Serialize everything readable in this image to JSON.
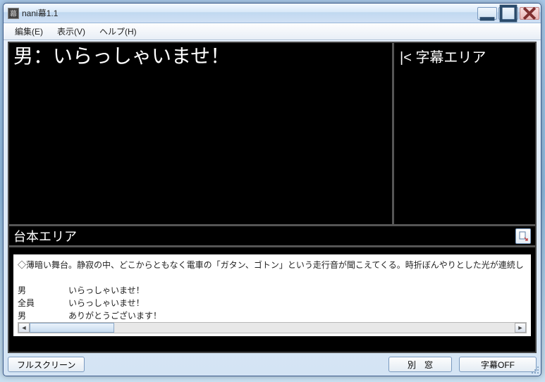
{
  "window": {
    "title": "nani幕1.1"
  },
  "menu": {
    "edit": "編集(E)",
    "view": "表示(V)",
    "help": "ヘルプ(H)"
  },
  "subtitle": {
    "main_text": "男：いらっしゃいませ！",
    "side_prefix": "|<",
    "side_label": "字幕エリア"
  },
  "script": {
    "header": "台本エリア",
    "direction": "◇薄暗い舞台。静寂の中、どこからともなく電車の「ガタン、ゴトン」という走行音が聞こえてくる。時折ぼんやりとした光が連続し",
    "lines": [
      {
        "speaker": "男",
        "text": "いらっしゃいませ！"
      },
      {
        "speaker": "全員",
        "text": "いらっしゃいませ！"
      },
      {
        "speaker": "男",
        "text": "ありがとうございます！"
      }
    ]
  },
  "buttons": {
    "fullscreen": "フルスクリーン",
    "separate_window": "別　窓",
    "subtitle_off": "字幕OFF"
  }
}
